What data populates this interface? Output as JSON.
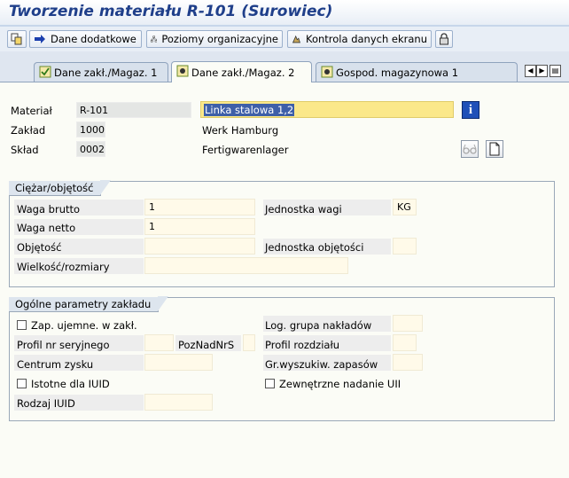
{
  "title": "Tworzenie materiału R-101 (Surowiec)",
  "toolbar": {
    "dane_dodatkowe": "Dane dodatkowe",
    "poziomy": "Poziomy organizacyjne",
    "kontrola": "Kontrola danych ekranu"
  },
  "tabs": [
    "Dane zakł./Magaz. 1",
    "Dane zakł./Magaz. 2",
    "Gospod. magazynowa 1"
  ],
  "header": {
    "material_label": "Materiał",
    "material_value": "R-101",
    "material_desc": "Linka stalowa 1,2",
    "zaklad_label": "Zakład",
    "zaklad_value": "1000",
    "zaklad_desc": "Werk Hamburg",
    "sklad_label": "Skład",
    "sklad_value": "0002",
    "sklad_desc": "Fertigwarenlager"
  },
  "weight_group": {
    "title": "Ciężar/objętość",
    "waga_brutto_label": "Waga brutto",
    "waga_brutto_value": "1",
    "waga_netto_label": "Waga netto",
    "waga_netto_value": "1",
    "objetosc_label": "Objętość",
    "objetosc_value": "",
    "wielkosc_label": "Wielkość/rozmiary",
    "wielkosc_value": "",
    "jednostka_wagi_label": "Jednostka wagi",
    "jednostka_wagi_value": "KG",
    "jednostka_obj_label": "Jednostka objętości",
    "jednostka_obj_value": ""
  },
  "plant_group": {
    "title": "Ogólne parametry zakładu",
    "zap_label": "Zap. ujemne. w zakł.",
    "profil_nr_label": "Profil nr seryjnego",
    "pozn_label": "PozNadNrS",
    "centrum_label": "Centrum zysku",
    "istotne_label": "Istotne dla IUID",
    "rodzaj_label": "Rodzaj IUID",
    "log_label": "Log. grupa nakładów",
    "profil_rozdz_label": "Profil rozdziału",
    "gr_label": "Gr.wyszukiw. zapasów",
    "zewn_label": "Zewnętrzne nadanie UII"
  },
  "colors": {
    "title": "#1f3f8a",
    "input_bg": "#fffae9",
    "highlight": "#fbe88a",
    "panel": "#fbfcf6"
  }
}
